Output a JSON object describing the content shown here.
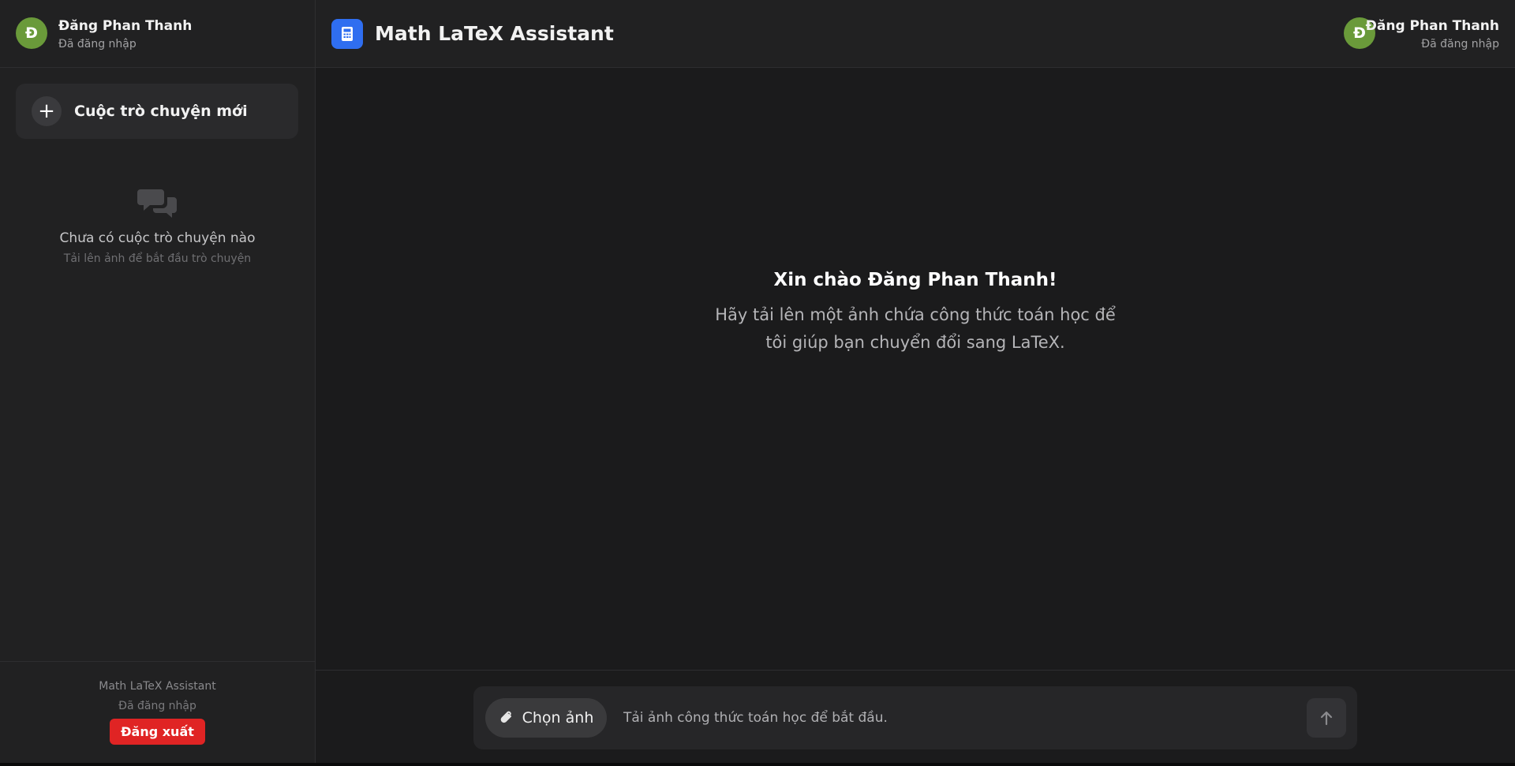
{
  "user": {
    "initial": "Đ",
    "name": "Đăng Phan Thanh",
    "status": "Đã đăng nhập"
  },
  "sidebar": {
    "new_chat_label": "Cuộc trò chuyện mới",
    "empty_title": "Chưa có cuộc trò chuyện nào",
    "empty_subtitle": "Tải lên ảnh để bắt đầu trò chuyện",
    "footer": {
      "app_name": "Math LaTeX Assistant",
      "status": "Đã đăng nhập",
      "logout_label": "Đăng xuất"
    }
  },
  "header": {
    "title": "Math LaTeX Assistant"
  },
  "welcome": {
    "title": "Xin chào Đăng Phan Thanh!",
    "body": "Hãy tải lên một ảnh chứa công thức toán học để tôi giúp bạn chuyển đổi sang LaTeX."
  },
  "composer": {
    "choose_image_label": "Chọn ảnh",
    "placeholder": "Tải ảnh công thức toán học để bắt đầu."
  },
  "icons": {
    "new_chat": "plus-icon",
    "empty": "chat-bubbles-icon",
    "logo": "calculator-icon",
    "attach": "paperclip-icon",
    "send": "arrow-up-icon"
  },
  "colors": {
    "background": "#1b1b1c",
    "sidebar": "#212122",
    "avatar": "#6a9a3a",
    "logo": "#2f6ef0",
    "logout": "#e02424"
  }
}
